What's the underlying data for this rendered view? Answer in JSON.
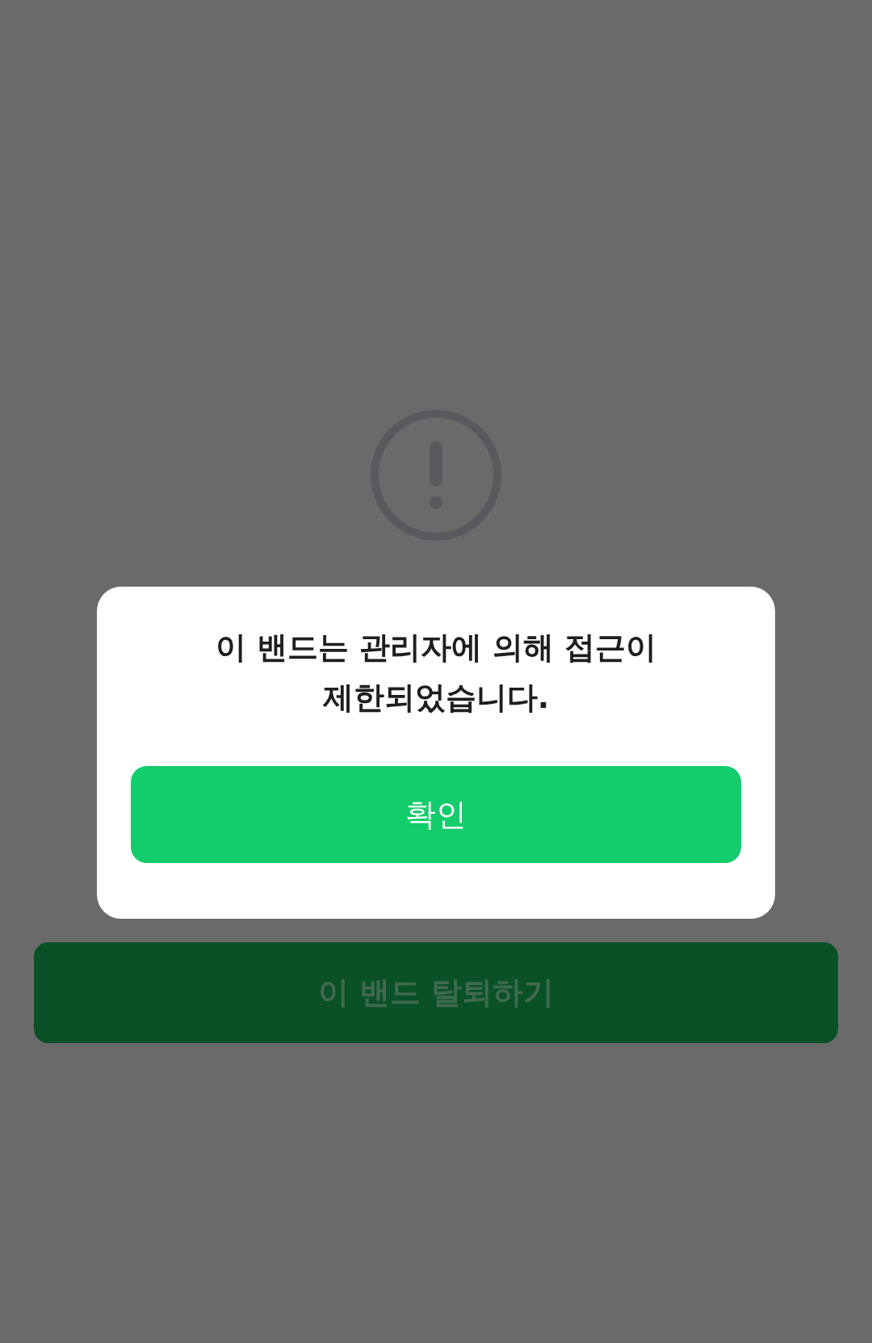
{
  "background": {
    "leave_button": "이 밴드 탈퇴하기"
  },
  "dialog": {
    "message": "이 밴드는 관리자에 의해 접근이\n제한되었습니다.",
    "confirm_button": "확인"
  }
}
